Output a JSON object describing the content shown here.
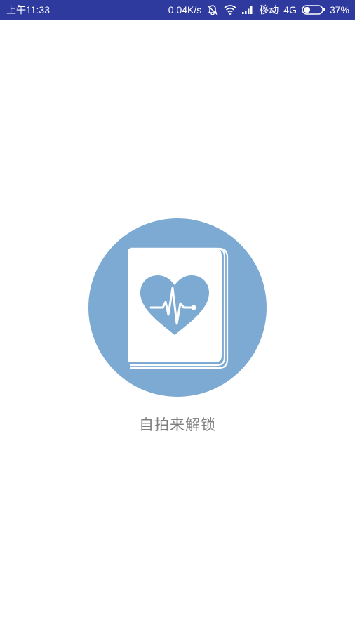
{
  "status_bar": {
    "time": "上午11:33",
    "net_speed": "0.04K/s",
    "carrier": "移动",
    "network_type": "4G",
    "battery_percent": "37%",
    "battery_level": 0.37,
    "background_color": "#2f3a9f"
  },
  "icons": {
    "silent": "alarm-off-icon",
    "wifi": "wifi-icon",
    "signal": "signal-icon",
    "battery": "battery-icon",
    "logo": "heart-book-icon"
  },
  "lock_screen": {
    "logo_color": "#7daad2",
    "unlock_label": "自拍来解锁"
  }
}
